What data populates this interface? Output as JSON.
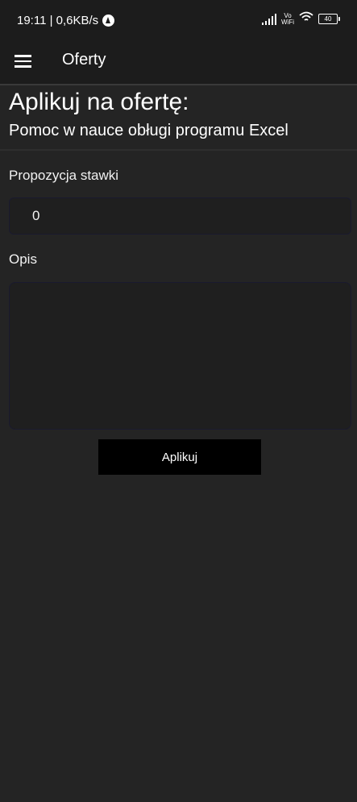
{
  "status_bar": {
    "time_speed": "19:11 | 0,6KB/s",
    "vowifi": "Vo WiFi",
    "battery": "40",
    "icons": [
      "app-notification-icon",
      "signal-icon",
      "vowifi-icon",
      "wifi-icon",
      "battery-icon"
    ]
  },
  "app_bar": {
    "title": "Oferty",
    "menu_icon": "hamburger-menu-icon"
  },
  "page": {
    "heading": "Aplikuj na ofertę:",
    "subheading": "Pomoc w nauce obługi programu Excel"
  },
  "form": {
    "rate_label": "Propozycja stawki",
    "rate_value": "0",
    "description_label": "Opis",
    "description_value": "",
    "submit_label": "Aplikuj"
  }
}
